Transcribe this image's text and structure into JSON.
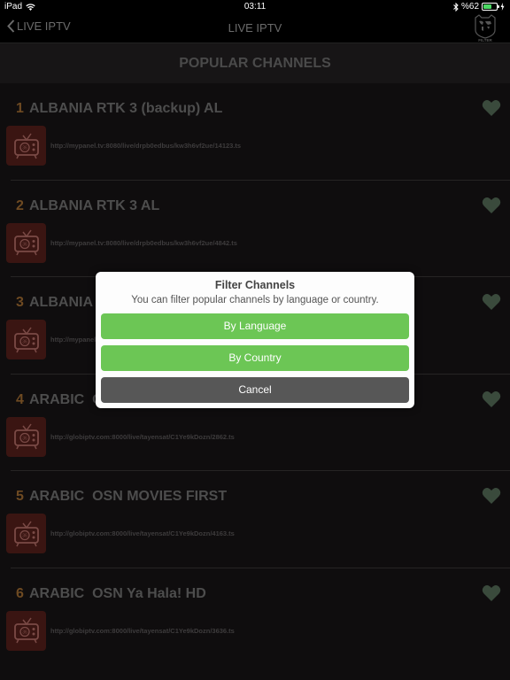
{
  "status_bar": {
    "device": "iPad",
    "time": "03:11",
    "battery_text": "%62",
    "battery_level": 0.62,
    "battery_color": "#4cd964"
  },
  "nav": {
    "back_label": "LIVE IPTV",
    "title": "LIVE IPTV",
    "filter_icon": "filter-world-map-icon",
    "filter_label": "FILTER"
  },
  "section": {
    "title": "POPULAR CHANNELS"
  },
  "channels": [
    {
      "number": "1",
      "name": "ALBANIA RTK 3 (backup) AL",
      "url": "http://mypanel.tv:8080/live/drpb0edbus/kw3h6vf2ue/14123.ts"
    },
    {
      "number": "2",
      "name": "ALBANIA RTK 3 AL",
      "url": "http://mypanel.tv:8080/live/drpb0edbus/kw3h6vf2ue/4842.ts"
    },
    {
      "number": "3",
      "name": "ALBANIA RTK 3 AL",
      "url": "http://mypanel.tv:8080/live/drpb0edbus/kw3h6vf2ue/"
    },
    {
      "number": "4",
      "name": "ARABIC  OSN",
      "url": "http://globiptv.com:8000/live/tayensat/C1Ye9kDozn/2862.ts"
    },
    {
      "number": "5",
      "name": "ARABIC  OSN MOVIES FIRST",
      "url": "http://globiptv.com:8000/live/tayensat/C1Ye9kDozn/4163.ts"
    },
    {
      "number": "6",
      "name": "ARABIC  OSN Ya Hala! HD",
      "url": "http://globiptv.com:8000/live/tayensat/C1Ye9kDozn/3636.ts"
    }
  ],
  "dialog": {
    "title": "Filter Channels",
    "message": "You can filter popular channels by language or country.",
    "buttons": {
      "language": "By Language",
      "country": "By Country",
      "cancel": "Cancel"
    },
    "colors": {
      "primary": "#6cc655",
      "cancel": "#575757"
    }
  },
  "colors": {
    "channel_number": "#6e4a22",
    "favorite_heart": "#3a4a3c",
    "thumb_bg": "#3a1512"
  }
}
